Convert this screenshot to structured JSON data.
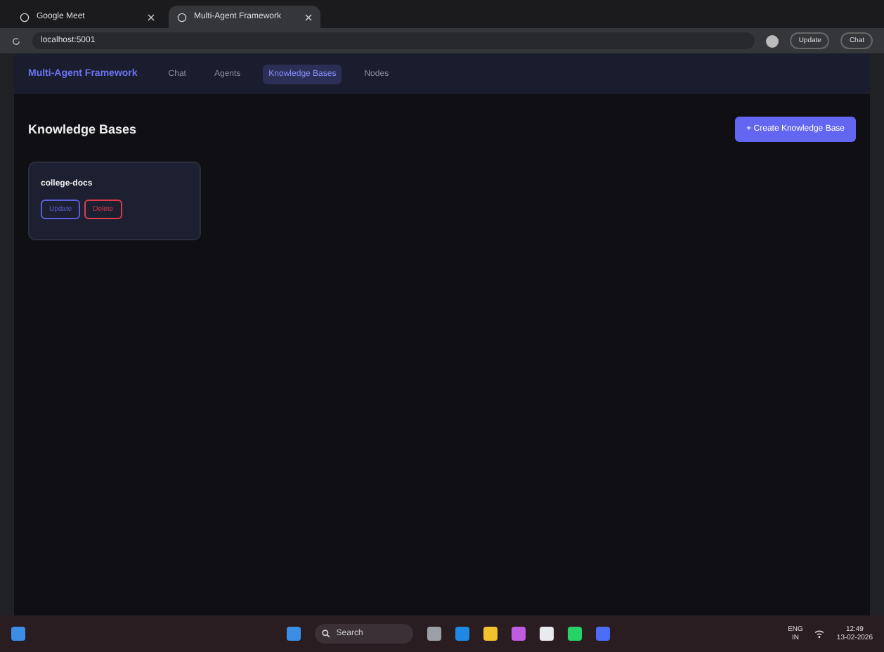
{
  "browser": {
    "tabs": [
      {
        "title": "Google Meet",
        "selected": false
      },
      {
        "title": "Multi-Agent Framework",
        "selected": true
      }
    ],
    "address": "localhost:5001",
    "update_label": "Update",
    "chat_label": "Chat"
  },
  "app": {
    "brand": "Multi-Agent Framework",
    "nav": [
      {
        "label": "Chat",
        "selected": false
      },
      {
        "label": "Agents",
        "selected": false
      },
      {
        "label": "Knowledge Bases",
        "selected": true
      },
      {
        "label": "Nodes",
        "selected": false
      }
    ],
    "title": "Knowledge Bases",
    "create_button": "+ Create Knowledge Base",
    "cards": [
      {
        "name": "college-docs",
        "actions": [
          {
            "label": "Update",
            "kind": "update"
          },
          {
            "label": "Delete",
            "kind": "delete"
          }
        ]
      }
    ]
  },
  "taskbar": {
    "search_placeholder": "Search",
    "lang": "ENG",
    "region": "IN",
    "time": "12:49",
    "date": "13-02-2026"
  }
}
